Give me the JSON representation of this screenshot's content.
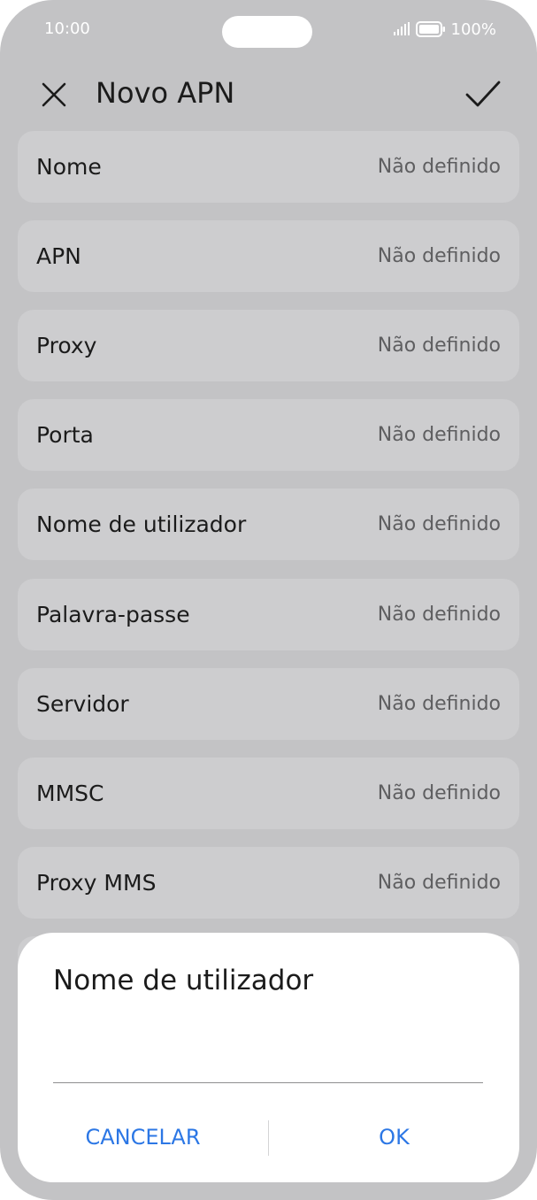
{
  "status_bar": {
    "time": "10:00",
    "battery": "100%",
    "icons": [
      "signal-icon",
      "battery-icon"
    ]
  },
  "header": {
    "title": "Novo APN",
    "close_icon": "close-icon",
    "confirm_icon": "check-icon"
  },
  "fields": [
    {
      "label": "Nome",
      "value": "Não definido"
    },
    {
      "label": "APN",
      "value": "Não definido"
    },
    {
      "label": "Proxy",
      "value": "Não definido"
    },
    {
      "label": "Porta",
      "value": "Não definido"
    },
    {
      "label": "Nome de utilizador",
      "value": "Não definido"
    },
    {
      "label": "Palavra-passe",
      "value": "Não definido"
    },
    {
      "label": "Servidor",
      "value": "Não definido"
    },
    {
      "label": "MMSC",
      "value": "Não definido"
    },
    {
      "label": "Proxy MMS",
      "value": "Não definido"
    }
  ],
  "dialog": {
    "title": "Nome de utilizador",
    "input_value": "",
    "cancel_label": "CANCELAR",
    "ok_label": "OK"
  },
  "colors": {
    "accent": "#2c77e5",
    "background": "#c3c3c5",
    "row": "#cdcdcf"
  }
}
